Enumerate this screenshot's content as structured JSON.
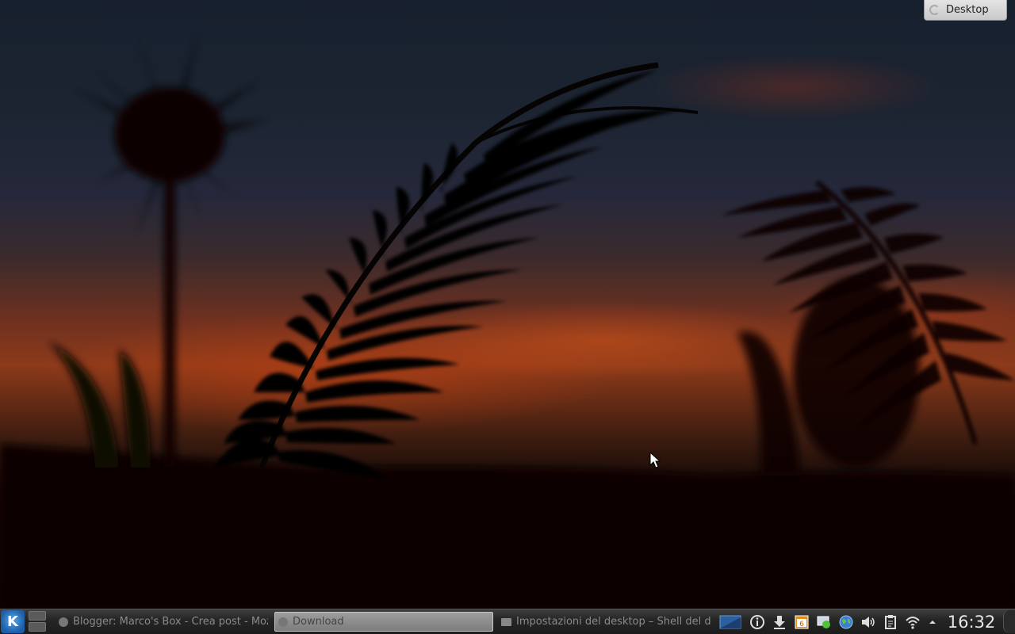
{
  "toolbox": {
    "label": "Desktop"
  },
  "panel": {
    "launcher_label": "K",
    "tasks": [
      {
        "label": "Blogger: Marco's Box - Crea post - Mozill"
      },
      {
        "label": "Download"
      },
      {
        "label": "Impostazioni del desktop – Shell del des"
      }
    ],
    "tray_icons": [
      "screen-icon",
      "info-icon",
      "download-icon",
      "calendar-icon",
      "notification-icon",
      "network-globe-icon",
      "volume-icon",
      "clipboard-icon",
      "wifi-icon",
      "expand-arrow-icon"
    ],
    "calendar_day": "6",
    "clock": "16:32"
  }
}
